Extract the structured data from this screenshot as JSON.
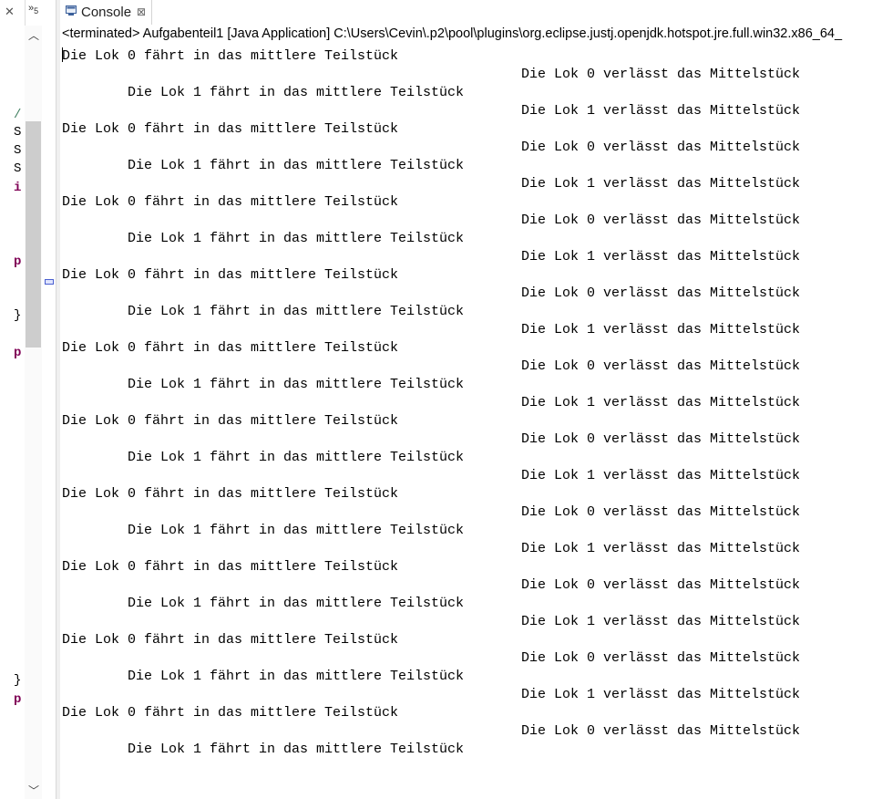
{
  "left_pane": {
    "overflow_label": "»",
    "overflow_count": "5",
    "code_fragments": [
      {
        "text": "/",
        "kind": "cm"
      },
      {
        "text": "S",
        "kind": "pl"
      },
      {
        "text": "S",
        "kind": "pl"
      },
      {
        "text": "S",
        "kind": "pl"
      },
      {
        "text": "i",
        "kind": "kw"
      },
      {
        "text": "p",
        "kind": "kw"
      },
      {
        "text": "}",
        "kind": "pl"
      },
      {
        "text": "p",
        "kind": "kw"
      },
      {
        "text": "}",
        "kind": "pl"
      },
      {
        "text": "p",
        "kind": "kw"
      }
    ]
  },
  "console": {
    "tab_label": "Console",
    "tab_icon": "console-icon",
    "close_icon": "close-icon",
    "status": "<terminated> Aufgabenteil1 [Java Application] C:\\Users\\Cevin\\.p2\\pool\\plugins\\org.eclipse.justj.openjdk.hotspot.jre.full.win32.x86_64_",
    "lines": [
      {
        "text": "Die Lok 0 fährt in das mittlere Teilstück",
        "indent": 0
      },
      {
        "text": "Die Lok 0 verlässt das Mittelstück",
        "indent": 2
      },
      {
        "text": "Die Lok 1 fährt in das mittlere Teilstück",
        "indent": 1
      },
      {
        "text": "Die Lok 1 verlässt das Mittelstück",
        "indent": 2
      },
      {
        "text": "Die Lok 0 fährt in das mittlere Teilstück",
        "indent": 0
      },
      {
        "text": "Die Lok 0 verlässt das Mittelstück",
        "indent": 2
      },
      {
        "text": "Die Lok 1 fährt in das mittlere Teilstück",
        "indent": 1
      },
      {
        "text": "Die Lok 1 verlässt das Mittelstück",
        "indent": 2
      },
      {
        "text": "Die Lok 0 fährt in das mittlere Teilstück",
        "indent": 0
      },
      {
        "text": "Die Lok 0 verlässt das Mittelstück",
        "indent": 2
      },
      {
        "text": "Die Lok 1 fährt in das mittlere Teilstück",
        "indent": 1
      },
      {
        "text": "Die Lok 1 verlässt das Mittelstück",
        "indent": 2
      },
      {
        "text": "Die Lok 0 fährt in das mittlere Teilstück",
        "indent": 0
      },
      {
        "text": "Die Lok 0 verlässt das Mittelstück",
        "indent": 2
      },
      {
        "text": "Die Lok 1 fährt in das mittlere Teilstück",
        "indent": 1
      },
      {
        "text": "Die Lok 1 verlässt das Mittelstück",
        "indent": 2
      },
      {
        "text": "Die Lok 0 fährt in das mittlere Teilstück",
        "indent": 0
      },
      {
        "text": "Die Lok 0 verlässt das Mittelstück",
        "indent": 2
      },
      {
        "text": "Die Lok 1 fährt in das mittlere Teilstück",
        "indent": 1
      },
      {
        "text": "Die Lok 1 verlässt das Mittelstück",
        "indent": 2
      },
      {
        "text": "Die Lok 0 fährt in das mittlere Teilstück",
        "indent": 0
      },
      {
        "text": "Die Lok 0 verlässt das Mittelstück",
        "indent": 2
      },
      {
        "text": "Die Lok 1 fährt in das mittlere Teilstück",
        "indent": 1
      },
      {
        "text": "Die Lok 1 verlässt das Mittelstück",
        "indent": 2
      },
      {
        "text": "Die Lok 0 fährt in das mittlere Teilstück",
        "indent": 0
      },
      {
        "text": "Die Lok 0 verlässt das Mittelstück",
        "indent": 2
      },
      {
        "text": "Die Lok 1 fährt in das mittlere Teilstück",
        "indent": 1
      },
      {
        "text": "Die Lok 1 verlässt das Mittelstück",
        "indent": 2
      },
      {
        "text": "Die Lok 0 fährt in das mittlere Teilstück",
        "indent": 0
      },
      {
        "text": "Die Lok 0 verlässt das Mittelstück",
        "indent": 2
      },
      {
        "text": "Die Lok 1 fährt in das mittlere Teilstück",
        "indent": 1
      },
      {
        "text": "Die Lok 1 verlässt das Mittelstück",
        "indent": 2
      },
      {
        "text": "Die Lok 0 fährt in das mittlere Teilstück",
        "indent": 0
      },
      {
        "text": "Die Lok 0 verlässt das Mittelstück",
        "indent": 2
      },
      {
        "text": "Die Lok 1 fährt in das mittlere Teilstück",
        "indent": 1
      },
      {
        "text": "Die Lok 1 verlässt das Mittelstück",
        "indent": 2
      },
      {
        "text": "Die Lok 0 fährt in das mittlere Teilstück",
        "indent": 0
      },
      {
        "text": "Die Lok 0 verlässt das Mittelstück",
        "indent": 2
      },
      {
        "text": "Die Lok 1 fährt in das mittlere Teilstück",
        "indent": 1
      }
    ]
  }
}
